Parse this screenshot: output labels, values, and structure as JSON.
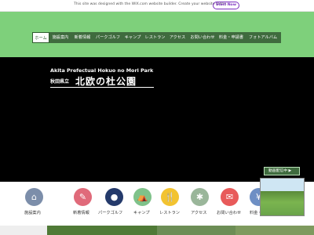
{
  "wix_bar": {
    "message": "This site was designed with the WIX.com website builder. Create your website today.",
    "button": "Start Now"
  },
  "nav": {
    "items": [
      "ホーム",
      "施設案内",
      "新着情報",
      "パークゴルフ",
      "キャンプ",
      "レストラン",
      "アクセス",
      "お問い合わせ",
      "料金・申請書",
      "フォトアルバム"
    ]
  },
  "logo": {
    "english": "Akita Prefectual Hokuo no Mori Park",
    "prefix": "秋田県立",
    "name": "北欧の杜公園"
  },
  "video_button": "動画配信中 ▶",
  "icons": [
    {
      "label": "施設案内",
      "color": "#7c8eaa",
      "glyph": "⌂"
    },
    {
      "label": "新着情報",
      "color": "#e06a7a",
      "glyph": "✎"
    },
    {
      "label": "パークゴルフ",
      "color": "#243a6b",
      "glyph": "●"
    },
    {
      "label": "キャンプ",
      "color": "#7fc28a",
      "glyph": "⛺"
    },
    {
      "label": "レストラン",
      "color": "#f2c331",
      "glyph": "🍴"
    },
    {
      "label": "アクセス",
      "color": "#9ab69a",
      "glyph": "✱"
    },
    {
      "label": "お問い合わせ",
      "color": "#e85a5a",
      "glyph": "✉"
    },
    {
      "label": "料金・申請書",
      "color": "#6e8fc4",
      "glyph": "¥"
    }
  ]
}
